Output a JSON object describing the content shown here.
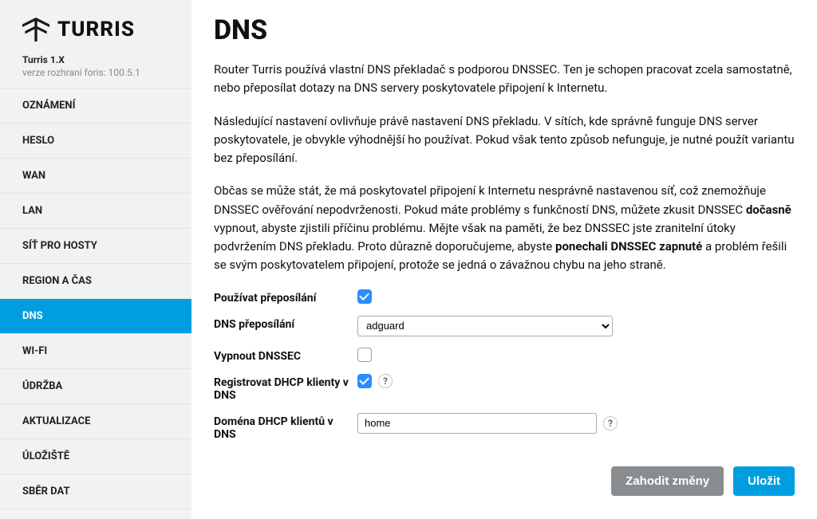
{
  "brand": {
    "name": "TURRIS"
  },
  "device": {
    "name": "Turris 1.X",
    "version": "verze rozhraní foris: 100.5.1"
  },
  "nav": {
    "items": [
      {
        "label": "OZNÁMENÍ",
        "key": "oznameni"
      },
      {
        "label": "HESLO",
        "key": "heslo"
      },
      {
        "label": "WAN",
        "key": "wan"
      },
      {
        "label": "LAN",
        "key": "lan"
      },
      {
        "label": "SÍŤ PRO HOSTY",
        "key": "hosty"
      },
      {
        "label": "REGION A ČAS",
        "key": "region"
      },
      {
        "label": "DNS",
        "key": "dns"
      },
      {
        "label": "WI-FI",
        "key": "wifi"
      },
      {
        "label": "ÚDRŽBA",
        "key": "udrzba"
      },
      {
        "label": "AKTUALIZACE",
        "key": "aktualizace"
      },
      {
        "label": "ÚLOŽIŠTĚ",
        "key": "uloziste"
      },
      {
        "label": "SBĚR DAT",
        "key": "sber"
      }
    ],
    "active_key": "dns"
  },
  "page": {
    "title": "DNS",
    "p1": "Router Turris používá vlastní DNS překladač s podporou DNSSEC. Ten je schopen pracovat zcela samostatně, nebo přeposílat dotazy na DNS servery poskytovatele připojení k Internetu.",
    "p2": "Následující nastavení ovlivňuje právě nastavení DNS překladu. V sítích, kde správně funguje DNS server poskytovatele, je obvykle výhodnější ho používat. Pokud však tento způsob nefunguje, je nutné použít variantu bez přeposílání.",
    "p3_a": "Občas se může stát, že má poskytovatel připojení k Internetu nesprávně nastavenou síť, což znemožňuje DNSSEC ověřování nepodvrženosti. Pokud máte problémy s funkčností DNS, můžete zkusit DNSSEC ",
    "p3_b1": "dočasně",
    "p3_c": " vypnout, abyste zjistili příčinu problému. Mějte však na paměti, že bez DNSSEC jste zranitelní útoky podvržením DNS překladu. Proto důrazně doporučujeme, abyste ",
    "p3_b2": "ponechali DNSSEC zapnuté",
    "p3_d": " a problém řešili se svým poskytovatelem připojení, protože se jedná o závažnou chybu na jeho straně."
  },
  "form": {
    "use_forwarding_label": "Používat přeposílání",
    "use_forwarding_checked": true,
    "dns_forwarding_label": "DNS přeposílání",
    "dns_forwarding_value": "adguard",
    "disable_dnssec_label": "Vypnout DNSSEC",
    "disable_dnssec_checked": false,
    "register_dhcp_label": "Registrovat DHCP klienty v DNS",
    "register_dhcp_checked": true,
    "dhcp_domain_label": "Doména DHCP klientů v DNS",
    "dhcp_domain_value": "home"
  },
  "buttons": {
    "discard": "Zahodit změny",
    "save": "Uložit"
  },
  "help_glyph": "?"
}
